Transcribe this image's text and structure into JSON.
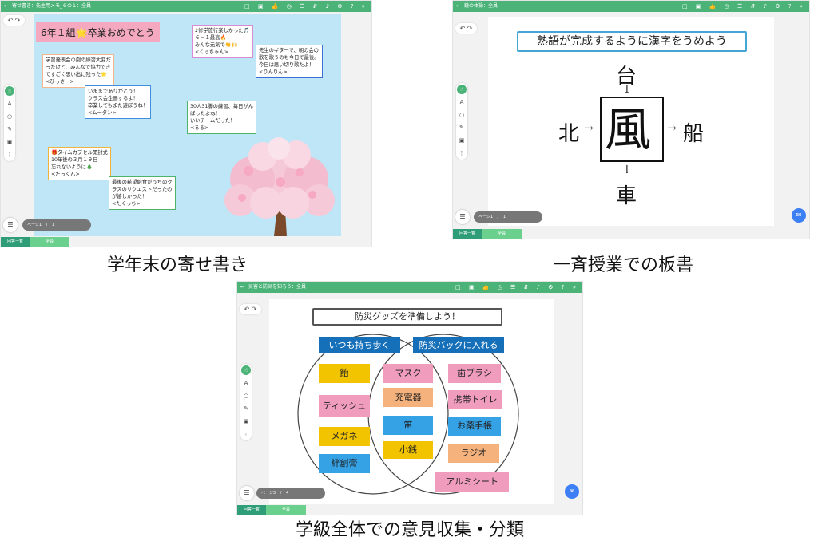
{
  "panel_a": {
    "topbar_title": "寄せ書き：先生用メモ_６の１：全員",
    "board_title": "6年１組🌟卒業おめでとう",
    "notes": [
      {
        "text": "学習発表会の劇の練習大変だ\nったけど、みんなで協力でき\nてすごく思い出に残った🌟\n<ひっさー>"
      },
      {
        "text": "♪修学旅行楽しかった🎵\n６－１最高🔥\nみんな元気で👏🙌\n<くぅちゃん>"
      },
      {
        "text": "先生のギターで、朝の会の\n歌を歌うのも今日で最後。\n今日は思い切り歌たよ！\n<りんりん>"
      },
      {
        "text": "いままでありがとう！\nクラス会企画するよ！\n卒業してもまた遊ぼうね！\n<ムータン>"
      },
      {
        "text": "30人31脚の練習、毎日がん\nばったよね！\nいいチームだった！\n<るる>"
      },
      {
        "text": "🎁タイムカプセル開封式\n10年後の３月１９日\n忘れないように🎄\n<たっくん>"
      },
      {
        "text": "最後の希望給食がうちのク\nラスのリクエストだったの\nが嬉しかった！\n<たくっち>"
      }
    ],
    "page_indicator": "ページ1 / 1",
    "tab_list": "回答一覧",
    "tab_all": "全員"
  },
  "panel_b": {
    "topbar_title": "鏡の体操：全員",
    "board_title": "熟語が完成するように漢字をうめよう",
    "top_char": "台",
    "left_char": "北",
    "right_char": "船",
    "bottom_char": "車",
    "center_char": "風",
    "arrow_down": "↓",
    "arrow_right": "→",
    "page_indicator": "ページ1 / 1",
    "tab_list": "回答一覧",
    "tab_all": "全員"
  },
  "panel_c": {
    "topbar_title": "災害と防災を知ろう：全員",
    "board_title": "防災グッズを準備しよう！",
    "headers": [
      "いつも持ち歩く",
      "防災バックに入れる"
    ],
    "cards": [
      "飴",
      "マスク",
      "歯ブラシ",
      "ティッシュ",
      "充電器",
      "携帯トイレ",
      "笛",
      "お薬手帳",
      "メガネ",
      "小銭",
      "ラジオ",
      "絆創膏",
      "アルミシート"
    ],
    "page_indicator": "ページ3 / 4",
    "tab_list": "回答一覧",
    "tab_all": "全員"
  },
  "captions": {
    "a": "学年末の寄せ書き",
    "b": "一斉授業での板書",
    "c": "学級全体での意見収集・分類"
  },
  "icons": {
    "back": "←",
    "toolbar_icons": "□ ▣ 👍 ◷ ☰ ⇵ ♪ ⚙ ? »",
    "undo": "↶ ↷",
    "tools": [
      "A",
      "○",
      "✎",
      "▣",
      "⋮"
    ],
    "hand": "☝",
    "menu": "☰",
    "chat": "✉"
  },
  "colors": {
    "app_green": "#4bb378",
    "board_a_bg": "#bfe6f6",
    "title_a_bg": "#f4a9c0",
    "header_blue": "#1670b9"
  }
}
